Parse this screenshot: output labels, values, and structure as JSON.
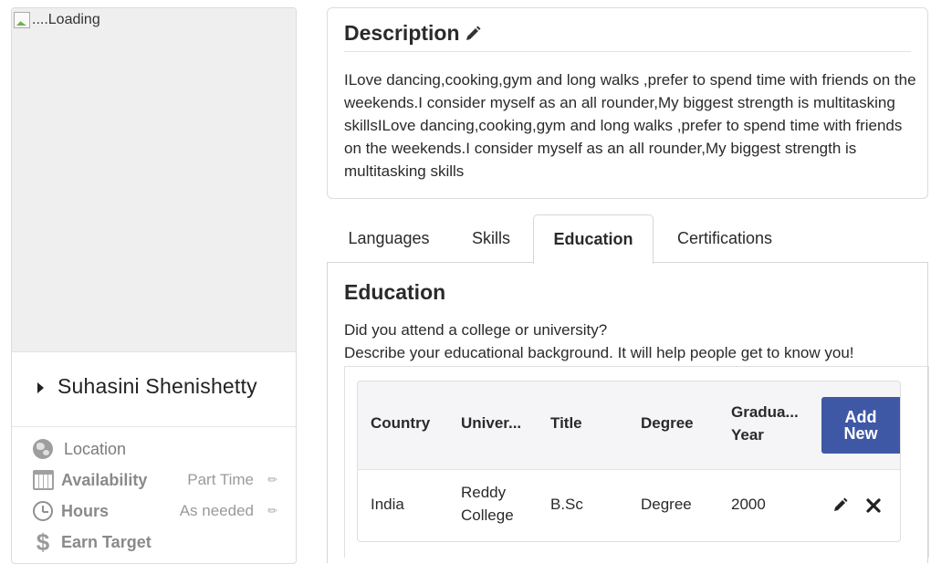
{
  "profile": {
    "photo_alt": "....Loading",
    "name": "Suhasini Shenishetty",
    "info": [
      {
        "icon": "globe-icon",
        "label": "Location",
        "value": ""
      },
      {
        "icon": "calendar-icon",
        "label": "Availability",
        "value": "Part Time"
      },
      {
        "icon": "clock-icon",
        "label": "Hours",
        "value": "As needed"
      },
      {
        "icon": "dollar-icon",
        "label": "Earn Target",
        "value": ""
      }
    ]
  },
  "description": {
    "title": "Description",
    "text": "ILove dancing,cooking,gym and long walks ,prefer to spend time with friends on the weekends.I consider myself as an all rounder,My biggest strength is multitasking skillsILove dancing,cooking,gym and long walks ,prefer to spend time with friends on the weekends.I consider myself as an all rounder,My biggest strength is multitasking skills"
  },
  "tabs": [
    "Languages",
    "Skills",
    "Education",
    "Certifications"
  ],
  "active_tab": "Education",
  "education": {
    "title": "Education",
    "question": "Did you attend a college or university?",
    "hint": "Describe your educational background. It will help people get to know you!",
    "columns": [
      "Country",
      "Univer...",
      "Title",
      "Degree",
      "Gradua...",
      "Year"
    ],
    "add_button": "Add New",
    "rows": [
      {
        "country": "India",
        "university_1": "Reddy",
        "university_2": "College",
        "title": "B.Sc",
        "degree": "Degree",
        "year": "2000"
      }
    ]
  },
  "colors": {
    "accent": "#3e58a6",
    "border": "#dcdcdc",
    "muted": "#9a9a9a"
  }
}
